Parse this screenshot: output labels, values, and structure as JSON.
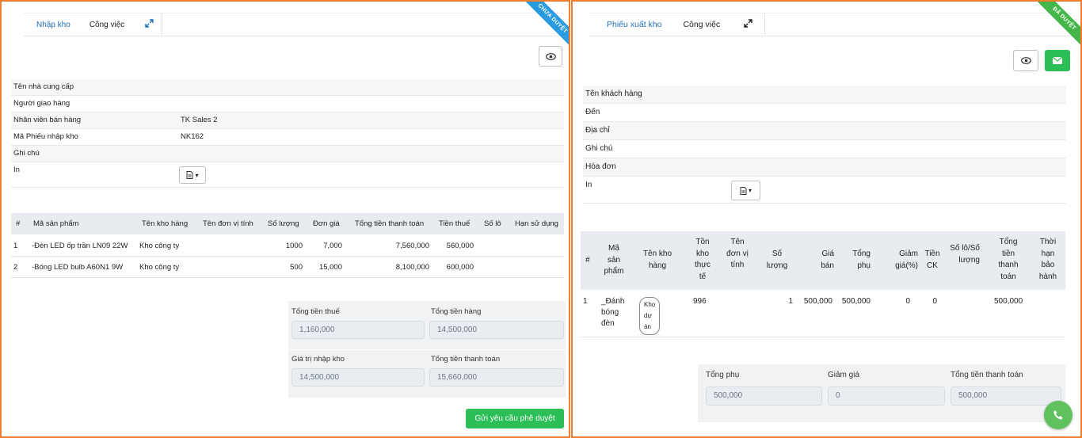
{
  "left": {
    "tabs": [
      "Nhập kho",
      "Công việc"
    ],
    "ribbon": "CHƯA DUYỆT",
    "fields": [
      {
        "label": "Tên nhà cung cấp",
        "value": ""
      },
      {
        "label": "Người giao hàng",
        "value": ""
      },
      {
        "label": "Nhân viên bán hàng",
        "value": "TK Sales 2"
      },
      {
        "label": "Mã Phiếu nhập kho",
        "value": "NK162"
      },
      {
        "label": "Ghi chú",
        "value": ""
      },
      {
        "label": "In",
        "value": ""
      }
    ],
    "columns": [
      "#",
      "Mã sản phẩm",
      "Tên kho hàng",
      "Tên đơn vị tính",
      "Số lượng",
      "Đơn giá",
      "Tổng tiền thanh toán",
      "Tiền thuế",
      "Số lô",
      "Hạn sử dụng"
    ],
    "rows": [
      {
        "no": "1",
        "product": "-Đèn LED ốp trần LN09 22W",
        "warehouse": "Kho công ty",
        "unit": "",
        "qty": "1000",
        "price": "7,000",
        "total": "7,560,000",
        "tax": "560,000",
        "lot": "",
        "expiry": ""
      },
      {
        "no": "2",
        "product": "-Bóng LED bulb A60N1 9W",
        "warehouse": "Kho công ty",
        "unit": "",
        "qty": "500",
        "price": "15,000",
        "total": "8,100,000",
        "tax": "600,000",
        "lot": "",
        "expiry": ""
      }
    ],
    "summary": {
      "tax_label": "Tổng tiền thuế",
      "tax_value": "1,160,000",
      "goods_label": "Tổng tiền hàng",
      "goods_value": "14,500,000",
      "import_label": "Giá trị nhập kho",
      "import_value": "14,500,000",
      "pay_label": "Tổng tiền thanh toán",
      "pay_value": "15,660,000"
    },
    "submit_label": "Gửi yêu cầu phê duyệt"
  },
  "right": {
    "tabs": [
      "Phiếu xuất kho",
      "Công việc"
    ],
    "ribbon": "ĐÃ DUYỆT",
    "fields": [
      {
        "label": "Tên khách hàng",
        "value": ""
      },
      {
        "label": "Đến",
        "value": ""
      },
      {
        "label": "Địa chỉ",
        "value": ""
      },
      {
        "label": "Ghi chú",
        "value": ""
      },
      {
        "label": "Hóa đơn",
        "value": ""
      },
      {
        "label": "In",
        "value": ""
      }
    ],
    "columns": [
      "#",
      "Mã sản phẩm",
      "Tên kho hàng",
      "Tồn kho thực tế",
      "Tên đơn vị tính",
      "Số lượng",
      "Giá bán",
      "Tổng phụ",
      "Giảm giá(%)",
      "Tiền CK",
      "Số lô/Số lượng",
      "Tổng tiền thanh toán",
      "Thời hạn bảo hành"
    ],
    "rows": [
      {
        "no": "1",
        "product": "_Đánh bóng đèn",
        "warehouse": "Kho dự án",
        "stock": "996",
        "unit": "",
        "qty": "1",
        "price": "500,000",
        "subtotal": "500,000",
        "discount": "0",
        "ck": "0",
        "lot": "",
        "total": "500,000",
        "warranty": ""
      }
    ],
    "summary": {
      "subtotal_label": "Tổng phụ",
      "subtotal_value": "500,000",
      "discount_label": "Giảm giá",
      "discount_value": "0",
      "pay_label": "Tổng tiền thanh toán",
      "pay_value": "500,000"
    }
  },
  "colors": {
    "accent": "#1f6fba",
    "green": "#2dbf57",
    "border": "#f07e2e",
    "ribbon_blue": "#2a9be0",
    "ribbon_green": "#45b649"
  }
}
